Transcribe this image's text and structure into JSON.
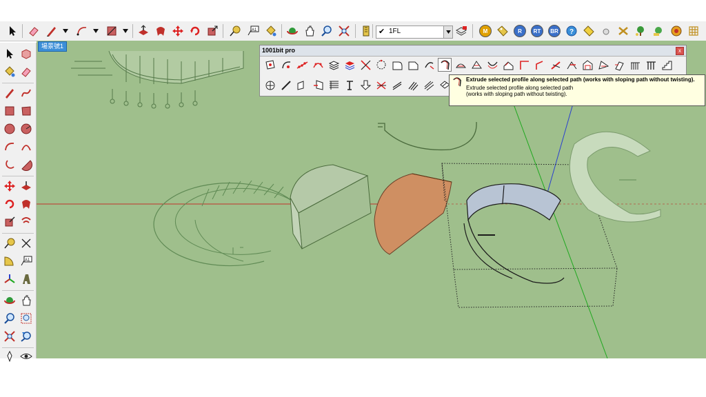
{
  "toolbar": {
    "layer": {
      "check": "✔",
      "name": "1FL"
    },
    "ruby_buttons": [
      "M",
      "R",
      "RT",
      "BR"
    ]
  },
  "viewport": {
    "scene_tab": "場景號1"
  },
  "panel": {
    "title": "1001bit pro",
    "close": "x"
  },
  "tooltip": {
    "title": "Extrude selected profile along selected path (works with sloping path without twisting).",
    "body": "Extrude selected profile along selected path (works with sloping path without twisting)."
  },
  "colors": {
    "background": "#9fbf8c",
    "red_axis": "#c0302a",
    "green_axis": "#1fa81f",
    "blue_axis": "#2a3fd0",
    "accent_orange": "#d89a6b"
  }
}
